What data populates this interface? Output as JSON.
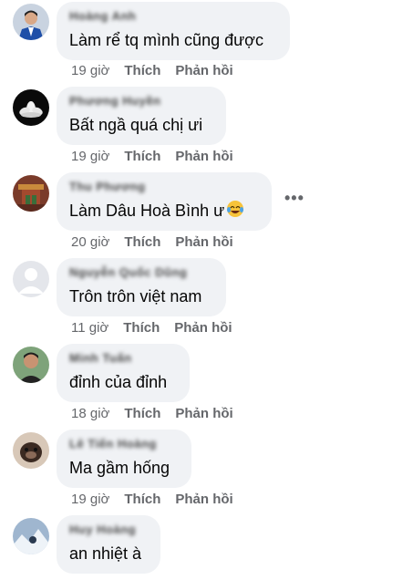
{
  "comments": [
    {
      "name": "Hoàng Anh",
      "text": "Làm rể tq mình cũng được",
      "time": "19 giờ",
      "like": "Thích",
      "reply": "Phản hồi"
    },
    {
      "name": "Phương Huyền",
      "text": "Bất ngầ quá chị ưi",
      "time": "19 giờ",
      "like": "Thích",
      "reply": "Phản hồi"
    },
    {
      "name": "Thu Phương",
      "text": "Làm Dâu Hoà Bình ư",
      "emoji": "laughing-tears-emoji",
      "time": "20 giờ",
      "like": "Thích",
      "reply": "Phản hồi"
    },
    {
      "name": "Nguyễn Quốc Dũng",
      "text": "Trôn trôn việt nam",
      "time": "11 giờ",
      "like": "Thích",
      "reply": "Phản hồi"
    },
    {
      "name": "Minh Tuấn",
      "text": "đỉnh của đỉnh",
      "time": "18 giờ",
      "like": "Thích",
      "reply": "Phản hồi"
    },
    {
      "name": "Lê Tiến Hoàng",
      "text": "Ma gầm hống",
      "time": "19 giờ",
      "like": "Thích",
      "reply": "Phản hồi"
    },
    {
      "name": "Huy Hoàng",
      "text": "an nhiệt à",
      "time": "",
      "like": "",
      "reply": ""
    }
  ],
  "more_menu": {
    "label": "•••",
    "icon": "more-options-icon"
  },
  "colors": {
    "bubble": "#f0f2f5",
    "meta": "#65676b",
    "text": "#050505"
  }
}
